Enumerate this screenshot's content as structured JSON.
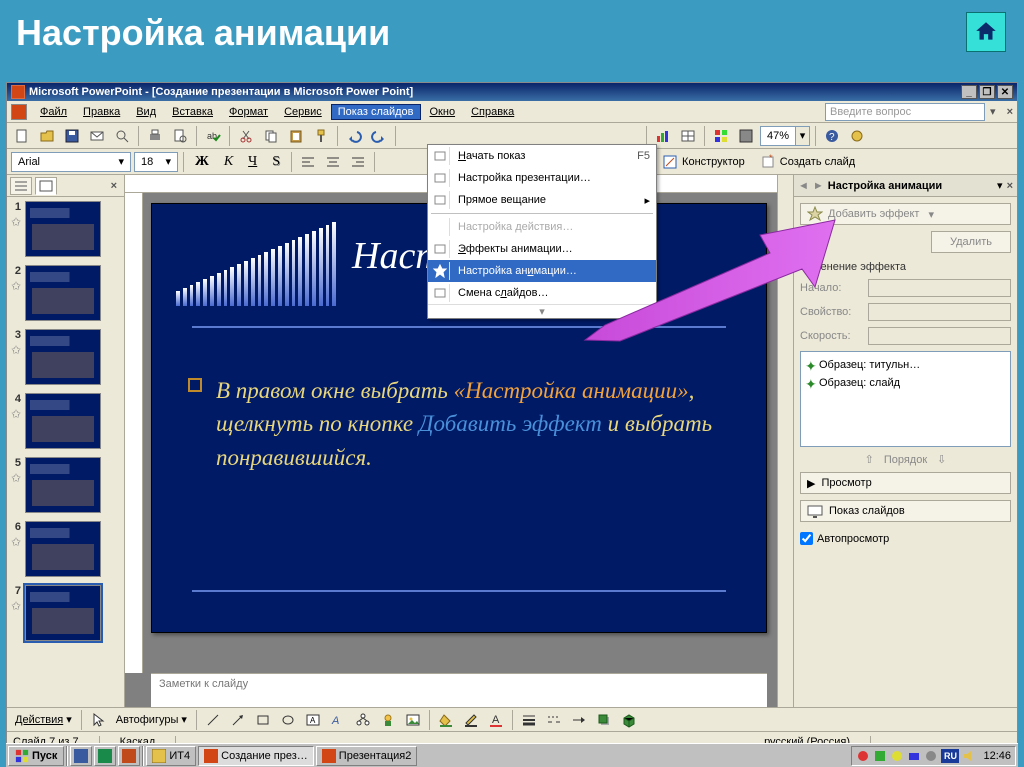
{
  "page_heading": "Настройка анимации",
  "titlebar": {
    "text": "Microsoft PowerPoint - [Создание презентации в Microsoft Power Point]"
  },
  "menu": {
    "items": [
      "Файл",
      "Правка",
      "Вид",
      "Вставка",
      "Формат",
      "Сервис",
      "Показ слайдов",
      "Окно",
      "Справка"
    ],
    "open_index": 6,
    "ask_placeholder": "Введите вопрос"
  },
  "toolbar": {
    "zoom": "47%"
  },
  "format": {
    "font": "Arial",
    "size": "18",
    "bold": "Ж",
    "italic": "К",
    "underline": "Ч",
    "shadow": "S",
    "designer": "Конструктор",
    "new_slide": "Создать слайд"
  },
  "dropdown": {
    "items": [
      {
        "label": "Начать показ",
        "shortcut": "F5",
        "disabled": false,
        "underline": 0
      },
      {
        "label": "Настройка презентации…",
        "disabled": false
      },
      {
        "label": "Прямое вещание",
        "submenu": true,
        "disabled": false
      },
      {
        "sep": true
      },
      {
        "label": "Настройка действия…",
        "disabled": true
      },
      {
        "label": "Эффекты анимации…",
        "disabled": false,
        "underline": 0
      },
      {
        "label": "Настройка анимации…",
        "disabled": false,
        "hover": true,
        "underline": 12
      },
      {
        "label": "Смена слайдов…",
        "disabled": false,
        "underline": 7
      }
    ]
  },
  "slide": {
    "title_visible": "Настр",
    "body_prefix": "В правом окне выбрать ",
    "body_em1": "«Настройка анимации»",
    "body_mid": ", щелкнуть по кнопке ",
    "body_em2": "Добавить эффект",
    "body_suffix": " и выбрать понравившийся."
  },
  "notes": {
    "placeholder": "Заметки к слайду"
  },
  "thumbs": {
    "count": 7,
    "selected": 7
  },
  "taskpane": {
    "title": "Настройка анимации",
    "add_effect": "Добавить эффект",
    "remove": "Удалить",
    "change_section": "Изменение эффекта",
    "start_label": "Начало:",
    "property_label": "Свойство:",
    "speed_label": "Скорость:",
    "list": [
      "Образец: титульн…",
      "Образец: слайд"
    ],
    "order": "Порядок",
    "preview": "Просмотр",
    "slideshow": "Показ слайдов",
    "autoview": "Автопросмотр"
  },
  "drawbar": {
    "actions": "Действия",
    "autoshapes": "Автофигуры"
  },
  "status": {
    "slide": "Слайд 7 из 7",
    "layout": "Каскад",
    "lang": "русский (Россия)"
  },
  "taskbar": {
    "start": "Пуск",
    "tasks": [
      "ИТ4",
      "Создание през…",
      "Презентация2"
    ],
    "active": 1,
    "lang_badge": "RU",
    "clock": "12:46"
  }
}
